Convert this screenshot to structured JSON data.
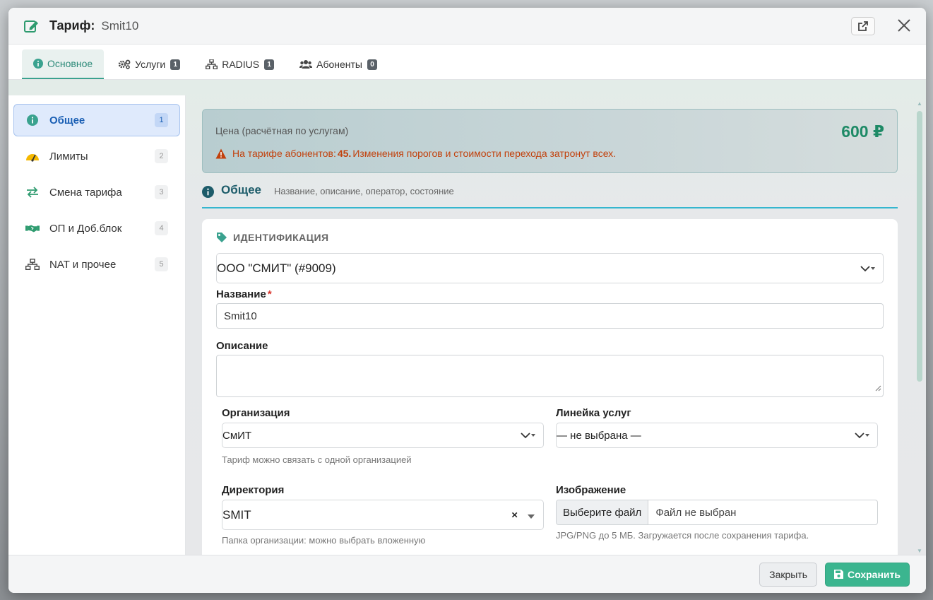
{
  "modal": {
    "title": "Тариф:",
    "subtitle": "Smit10"
  },
  "tabs": [
    {
      "label": "Основное",
      "icon": "info-circle-icon",
      "badge": ""
    },
    {
      "label": "Услуги",
      "icon": "gears-icon",
      "badge": "1"
    },
    {
      "label": "RADIUS",
      "icon": "network-icon",
      "badge": "1"
    },
    {
      "label": "Абоненты",
      "icon": "users-icon",
      "badge": "0"
    }
  ],
  "sidebar": {
    "items": [
      {
        "label": "Общее",
        "num": "1",
        "icon": "info-circle-icon"
      },
      {
        "label": "Лимиты",
        "num": "2",
        "icon": "gauge-icon"
      },
      {
        "label": "Смена тарифа",
        "num": "3",
        "icon": "exchange-arrows-icon"
      },
      {
        "label": "ОП и Доб.блок",
        "num": "4",
        "icon": "handshake-icon"
      },
      {
        "label": "NAT и прочее",
        "num": "5",
        "icon": "network-icon"
      }
    ]
  },
  "price": {
    "label": "Цена (расчётная по услугам)",
    "value": "600 ₽",
    "warn_prefix": "На тарифе абонентов:",
    "warn_count": "45.",
    "warn_text": "Изменения порогов и стоимости перехода затронут всех."
  },
  "section": {
    "title": "Общее",
    "subtitle": "Название, описание, оператор, состояние"
  },
  "identification": {
    "heading": "ИДЕНТИФИКАЦИЯ",
    "operator_value": "ООО \"СМИТ\" (#9009)",
    "name_label": "Название",
    "name_required": "*",
    "name_value": "Smit10",
    "description_label": "Описание",
    "description_value": "",
    "organization_label": "Организация",
    "organization_value": "СмИТ",
    "organization_hint": "Тариф можно связать с одной организацией",
    "service_line_label": "Линейка услуг",
    "service_line_value": "— не выбрана —",
    "directory_label": "Директория",
    "directory_value": "SMIT",
    "directory_clear": "×",
    "directory_hint": "Папка организации: можно выбрать вложенную",
    "image_label": "Изображение",
    "image_button": "Выберите файл",
    "image_filename": "Файл не выбран",
    "image_hint": "JPG/PNG до 5 МБ. Загружается после сохранения тарифа."
  },
  "footer": {
    "close_label": "Закрыть",
    "save_label": "Сохранить"
  },
  "colors": {
    "accent": "#3bb58f",
    "price": "#1e8a66",
    "warning": "#c2410c",
    "section_line": "#35b6cf",
    "active_sidebar": "#1a5fb4"
  }
}
